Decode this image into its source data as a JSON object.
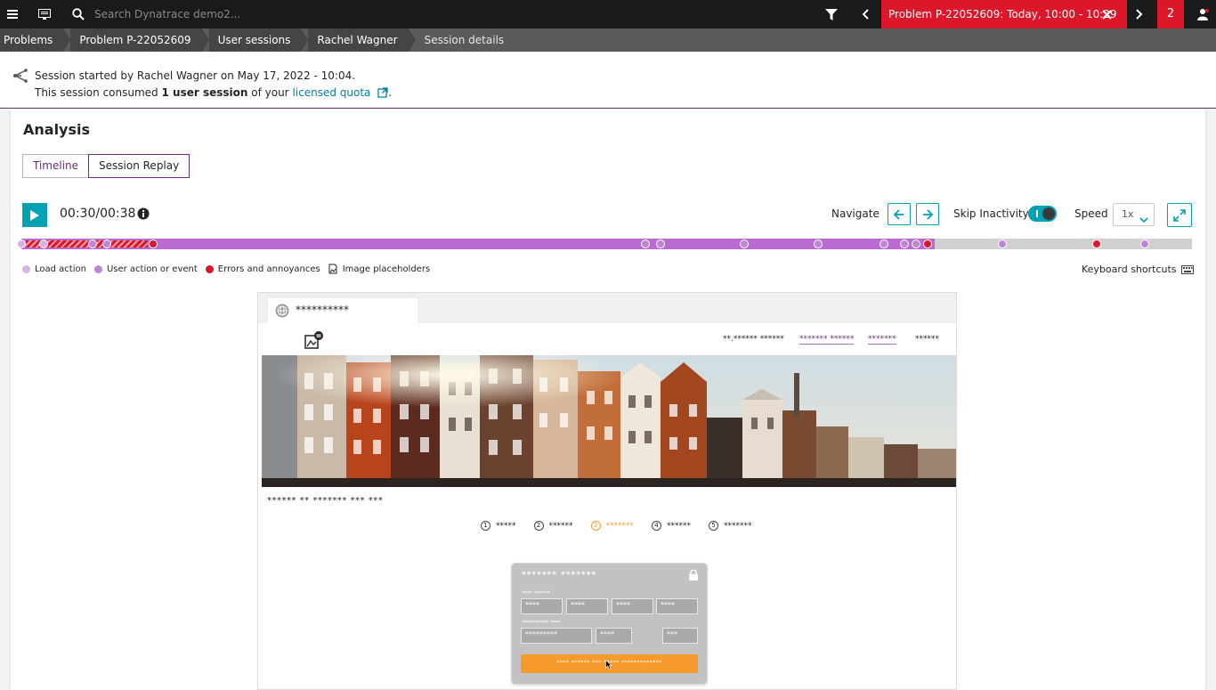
{
  "topbar": {
    "search_placeholder": "Search Dynatrace demo2...",
    "problem_label": "Problem P-22052609: Today, 10:00 - 10:29",
    "problem_count": "2"
  },
  "breadcrumb": [
    "Problems",
    "Problem P-22052609",
    "User sessions",
    "Rachel Wagner",
    "Session details"
  ],
  "session": {
    "line1": "Session started by Rachel Wagner on May 17, 2022 - 10:04.",
    "line2_prefix": "This session consumed",
    "line2_bold": "1 user session",
    "line2_mid": "of your",
    "line2_link": "licensed quota",
    "line2_suffix": "."
  },
  "analysis": {
    "title": "Analysis",
    "tabs": [
      "Timeline",
      "Session Replay"
    ],
    "active_tab": "Session Replay"
  },
  "player": {
    "time": "00:30/00:38",
    "navigate_label": "Navigate",
    "skip_label": "Skip Inactivity",
    "skip_inactivity_on": true,
    "speed_label": "Speed",
    "speed_value": "1x",
    "progress_fraction": 0.78
  },
  "legend": {
    "load_action": "Load action",
    "user_action": "User action or event",
    "errors": "Errors and annoyances",
    "image_placeholders": "Image placeholders",
    "keyboard_shortcuts": "Keyboard shortcuts"
  },
  "colors": {
    "load_action": "#d7b3e6",
    "user_action": "#c086d6",
    "error": "#dc172a",
    "accent": "#00a1b2",
    "brand": "#6d2c7b",
    "problem": "#dc172a"
  },
  "replay": {
    "tab_title": "**********",
    "nav_links": [
      "**.****** ******",
      "******* ******",
      "*******",
      "******"
    ],
    "caption": "****** ** ******* *** ***",
    "steps": [
      {
        "num": "1",
        "label": "*****"
      },
      {
        "num": "2",
        "label": "******"
      },
      {
        "num": "3",
        "label": "*******"
      },
      {
        "num": "4",
        "label": "******"
      },
      {
        "num": "5",
        "label": "*******"
      }
    ],
    "current_step": "3",
    "card": {
      "title": "******* *******",
      "label1": "**** ******",
      "fields_row1": [
        "****",
        "****",
        "****",
        "****"
      ],
      "label2": "********** ****",
      "fields_row2": [
        "*********",
        "****",
        "***"
      ],
      "submit": "**** ****** *** ***** *************"
    }
  }
}
